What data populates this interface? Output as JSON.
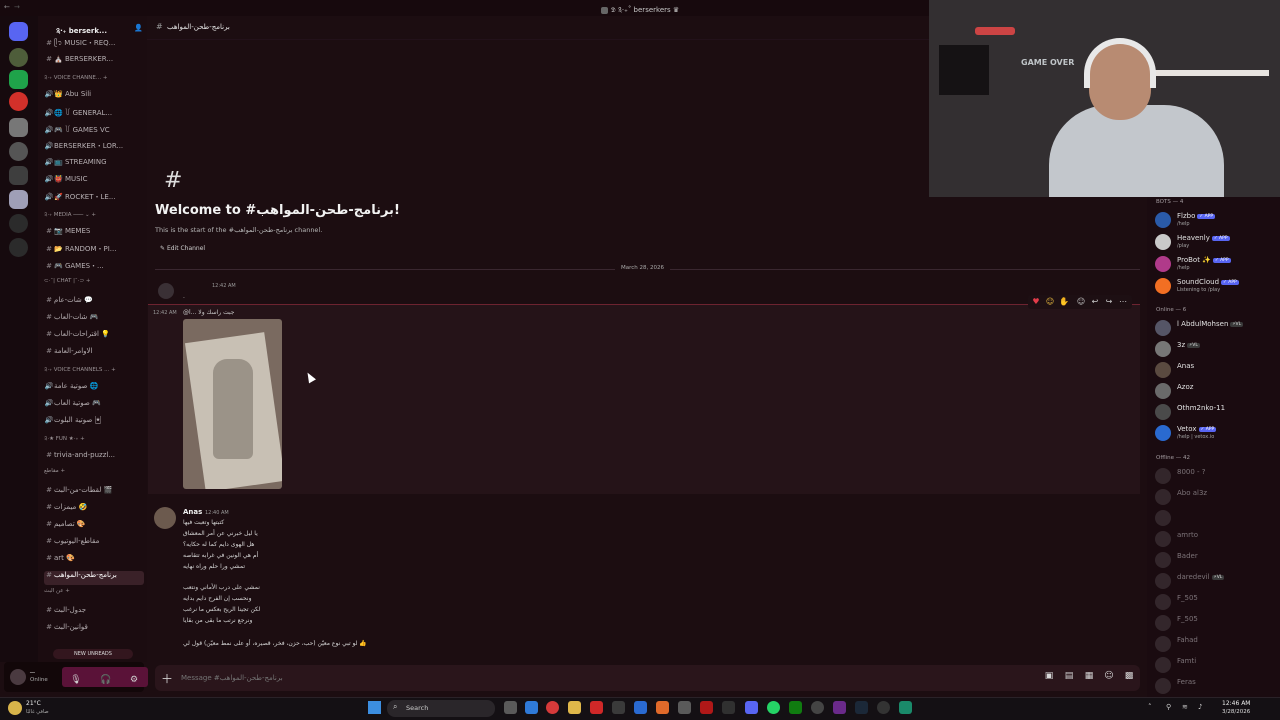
{
  "window": {
    "title": "𝕯 ༉‧₊˚ berserkers ♛"
  },
  "sidebar": {
    "server_name": "༉‧₊ berserk...",
    "channels": [
      {
        "label": "ᥫ᭡ MUSIC・REQ...",
        "icon": "#"
      },
      {
        "label": "⛪ BERSERKER...",
        "icon": "#"
      },
      {
        "label": "༉‧₊ VOICE CHANNE... +",
        "category": true
      },
      {
        "label": "👑 Abu Sili",
        "icon": "🔊"
      },
      {
        "label": "🌐 ꒦ GENERAL...",
        "icon": "🔊"
      },
      {
        "label": "🎮 ꒦ GAMES VC",
        "icon": "🔊"
      },
      {
        "label": "BERSERKER・LOR...",
        "icon": "🔊"
      },
      {
        "label": "📺 STREAMING",
        "icon": "🔊"
      },
      {
        "label": "👹 MUSIC",
        "icon": "🔊"
      },
      {
        "label": "🚀 ROCKET・LE...",
        "icon": "🔊"
      },
      {
        "label": "༉‧₊ MEDIA ─── ⌄ +",
        "category": true
      },
      {
        "label": "📷 MEMES",
        "icon": "#"
      },
      {
        "label": "📂 RANDOM・PI...",
        "icon": "#"
      },
      {
        "label": "🎮 GAMES・...",
        "icon": "#"
      },
      {
        "label": "⊂‧˚| CHAT |˚‧⊃ +",
        "category": true
      },
      {
        "label": "شات-عام 💬",
        "icon": "#"
      },
      {
        "label": "شات-العاب 🎮",
        "icon": "#"
      },
      {
        "label": "اقتراحات-العاب 💡",
        "icon": "#"
      },
      {
        "label": "الاوامر-العامة",
        "icon": "#"
      },
      {
        "label": "༉‧₊ Voice Channels ... +",
        "category": true
      },
      {
        "label": "صوتية عامة 🌐",
        "icon": "🔊"
      },
      {
        "label": "صوتية العاب 🎮",
        "icon": "🔊"
      },
      {
        "label": "صوتية البلوت 🃏",
        "icon": "🔊"
      },
      {
        "label": "༉‧★ FUN ★‧₊ +",
        "category": true
      },
      {
        "label": "trivia-and-puzzl...",
        "icon": "#"
      },
      {
        "label": "مقاطع +",
        "category": true
      },
      {
        "label": "لقطات-من-البث 🎬",
        "icon": "#"
      },
      {
        "label": "ميمزات 🤣",
        "icon": "#"
      },
      {
        "label": "تصاميم 🎨",
        "icon": "#"
      },
      {
        "label": "مقاطع-اليوتيوب",
        "icon": "#"
      },
      {
        "label": "art 🎨",
        "icon": "#"
      },
      {
        "label": "برنامج-طحن-المواهب",
        "icon": "#",
        "active": true
      },
      {
        "label": "عن البث +",
        "category": true
      },
      {
        "label": "جدول-البث",
        "icon": "#"
      },
      {
        "label": "قوانين-البث",
        "icon": "#"
      }
    ],
    "new_unreads": "NEW UNREADS"
  },
  "user": {
    "name": "ـــ",
    "status": "Online"
  },
  "chat": {
    "header_title": "برنامج-طحن-المواهب",
    "welcome_title": "Welcome to #برنامج-طحن-المواهب!",
    "welcome_sub": "This is the start of the #برنامج-طحن-المواهب channel.",
    "edit_channel": "Edit Channel",
    "date_divider": "March 28, 2026",
    "msg1": {
      "time": "12:42 AM",
      "text": "."
    },
    "msg2": {
      "time": "12:42 AM",
      "reply": "@l... جبت راسك ولا"
    },
    "msg3": {
      "author": "Anas",
      "time": "12:40 AM",
      "lines": [
        "كتبتها وتعبت فيها",
        "يا ليل خبرني عن أمر المعشاق",
        "هل الهوى دايم كما له حكايه؟",
        "أم هي الونين في غرابه تتقاصه",
        "تمشي ورا حلم وراه نهايه",
        "",
        "نمشي على درب الأماني ونتعب",
        "ونحسب إن الفرح دايم بدايه",
        "لكن تجينا الريح بعكس ما نرغب",
        "ونرجع نرتب ما بقى من بقايا",
        "",
        "لو تبي نوع معيّن (حب، حزن، فخر، قصيره، أو على نمط معيّن) قول لي 👍"
      ]
    },
    "composer_placeholder": "Message #برنامج-طحن-المواهب"
  },
  "webcam": {
    "sign_text": "GAME OVER"
  },
  "members": {
    "bots_header": "BOTS — 4",
    "bots": [
      {
        "name": "Flzbo",
        "tag": "✓ APP",
        "status": "/help"
      },
      {
        "name": "Heavenly",
        "tag": "✓ APP",
        "status": "/play"
      },
      {
        "name": "ProBot ✨",
        "tag": "✓ APP",
        "status": "/help"
      },
      {
        "name": "SoundCloud",
        "tag": "✓ APP",
        "status": "Listening to /play"
      }
    ],
    "online_header": "Online — 6",
    "online": [
      {
        "name": "l AbdulMohsen",
        "tag": "⚡VL",
        "status": ""
      },
      {
        "name": "3z",
        "tag": "⚡VL",
        "status": ""
      },
      {
        "name": "Anas",
        "tag": "",
        "status": ""
      },
      {
        "name": "Azoz",
        "tag": "",
        "status": ""
      },
      {
        "name": "Othm2nko-11",
        "tag": "",
        "status": ""
      },
      {
        "name": "Vetox",
        "tag": "✓ APP",
        "status": "/help | vetox.io"
      }
    ],
    "offline_header": "Offline — 42",
    "offline": [
      {
        "name": "8000 - ?",
        "tag": ""
      },
      {
        "name": "Abo al3z",
        "tag": ""
      },
      {
        "name": "",
        "tag": ""
      },
      {
        "name": "amrto",
        "tag": ""
      },
      {
        "name": "Bader",
        "tag": ""
      },
      {
        "name": "daredevil",
        "tag": "⚡VL"
      },
      {
        "name": "F_505",
        "tag": ""
      },
      {
        "name": "F_505",
        "tag": ""
      },
      {
        "name": "Fahad",
        "tag": ""
      },
      {
        "name": "Famti",
        "tag": ""
      },
      {
        "name": "Feras",
        "tag": ""
      }
    ]
  },
  "taskbar": {
    "weather_temp": "21°C",
    "weather_desc": "صافي غالبًا",
    "search_label": "Search",
    "clock_time": "12:46 AM",
    "clock_date": "3/28/2026"
  }
}
